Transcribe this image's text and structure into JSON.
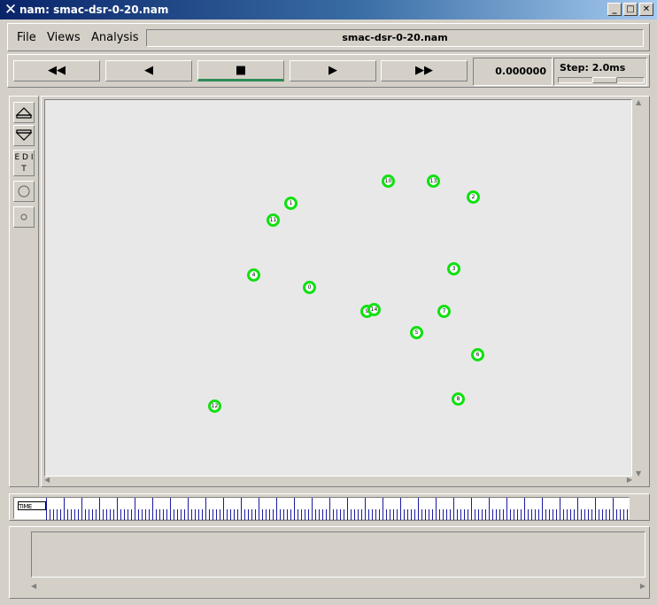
{
  "window": {
    "title": "nam: smac-dsr-0-20.nam",
    "logo_icon": "x-logo-icon",
    "controls": [
      "minimize",
      "maximize",
      "close"
    ]
  },
  "menu": {
    "file": "File",
    "views": "Views",
    "analysis": "Analysis",
    "filename": "smac-dsr-0-20.nam"
  },
  "transport": {
    "rewind": "◀◀",
    "back": "◀",
    "stop": "■",
    "play": "▶",
    "fast_forward": "▶▶",
    "time": "0.000000",
    "step_label": "Step: 2.0ms"
  },
  "tools": {
    "edit": "E D I T"
  },
  "timeline": {
    "label": "TIME"
  },
  "colors": {
    "node_ring": "#10e010",
    "canvas_bg": "#e8e8e8"
  },
  "nodes": [
    {
      "id": "0"
    },
    {
      "id": "1"
    },
    {
      "id": "2"
    },
    {
      "id": "3"
    },
    {
      "id": "4"
    },
    {
      "id": "5"
    },
    {
      "id": "6"
    },
    {
      "id": "7"
    },
    {
      "id": "8"
    },
    {
      "id": "9"
    },
    {
      "id": "10"
    },
    {
      "id": "11"
    },
    {
      "id": "12"
    },
    {
      "id": "13"
    },
    {
      "id": "14"
    }
  ]
}
